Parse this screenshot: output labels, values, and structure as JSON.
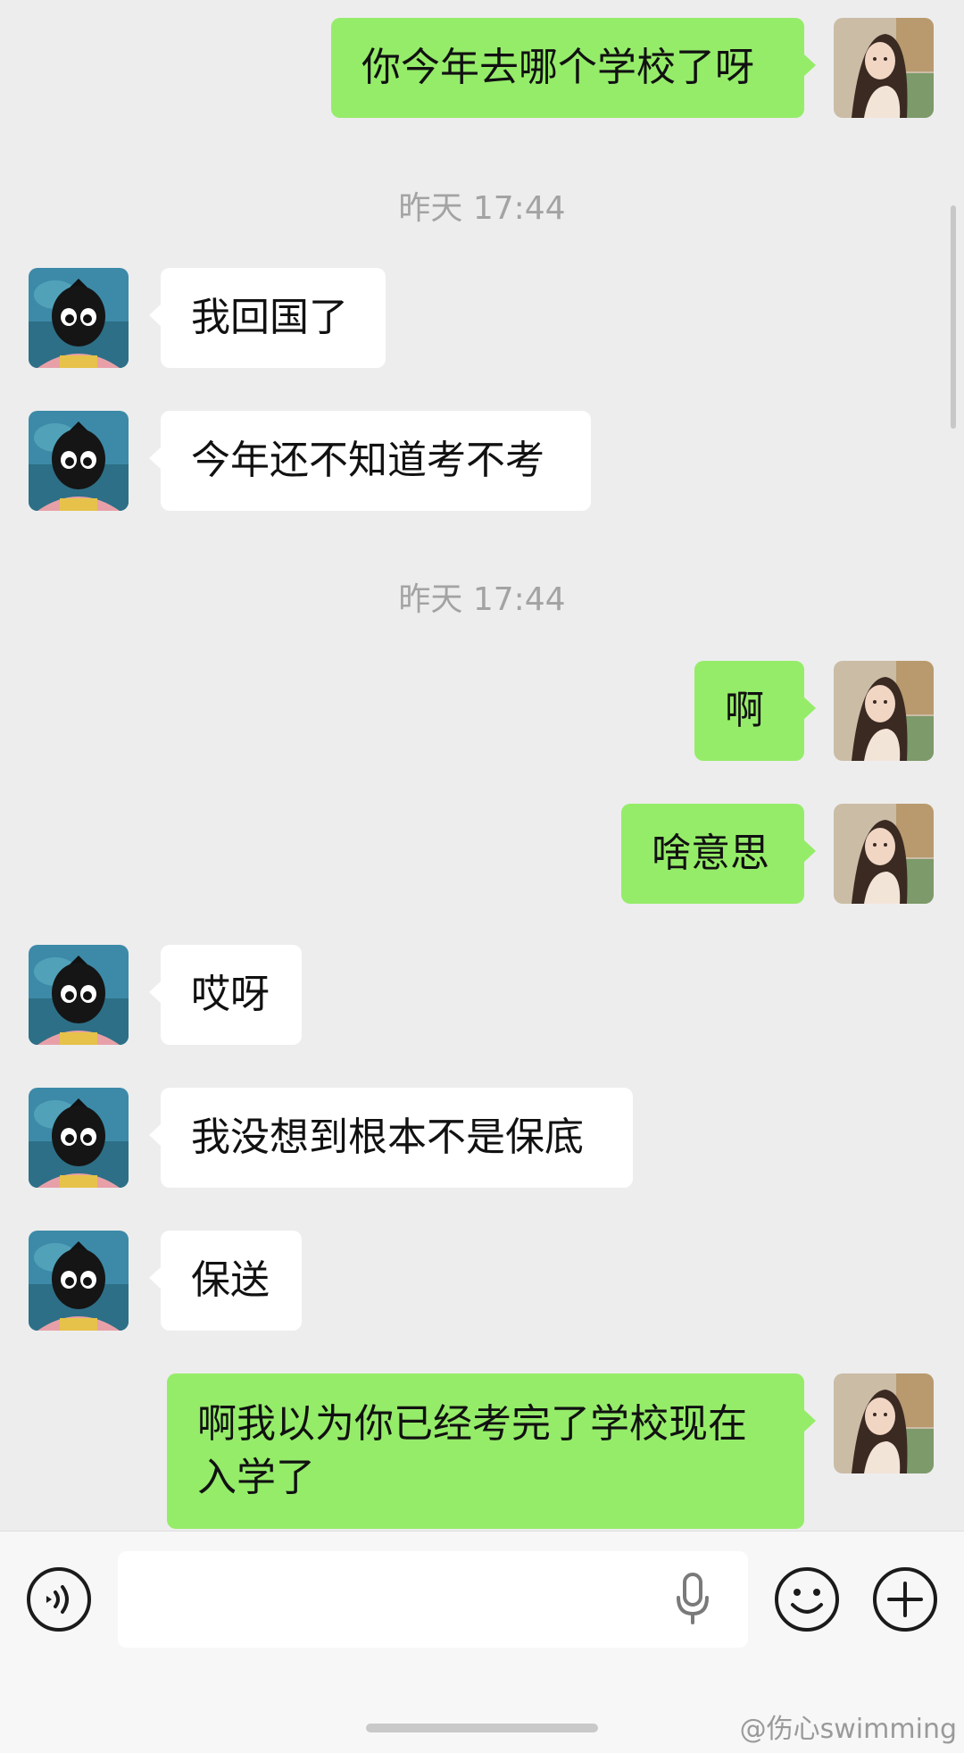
{
  "chat": {
    "messages": [
      {
        "side": "me",
        "text": "你今年去哪个学校了呀"
      },
      {
        "timestamp": "昨天 17:44"
      },
      {
        "side": "other",
        "text": "我回国了"
      },
      {
        "side": "other",
        "text": "今年还不知道考不考"
      },
      {
        "timestamp": "昨天 17:44"
      },
      {
        "side": "me",
        "text": "啊"
      },
      {
        "side": "me",
        "text": "啥意思"
      },
      {
        "side": "other",
        "text": "哎呀"
      },
      {
        "side": "other",
        "text": "我没想到根本不是保底"
      },
      {
        "side": "other",
        "text": "保送"
      },
      {
        "side": "me",
        "line1": "啊我以为你已经考完了学校现在",
        "line2": "入学了"
      }
    ]
  },
  "input_bar": {
    "voice_icon": "voice-toggle-icon",
    "mic_icon": "microphone-icon",
    "emoji_icon": "emoji-icon",
    "add_icon": "plus-icon"
  },
  "watermark": "@伤心swimming",
  "colors": {
    "my_bubble": "#95ec69",
    "other_bubble": "#ffffff",
    "background": "#ededed",
    "timestamp": "#a3a3a3"
  }
}
